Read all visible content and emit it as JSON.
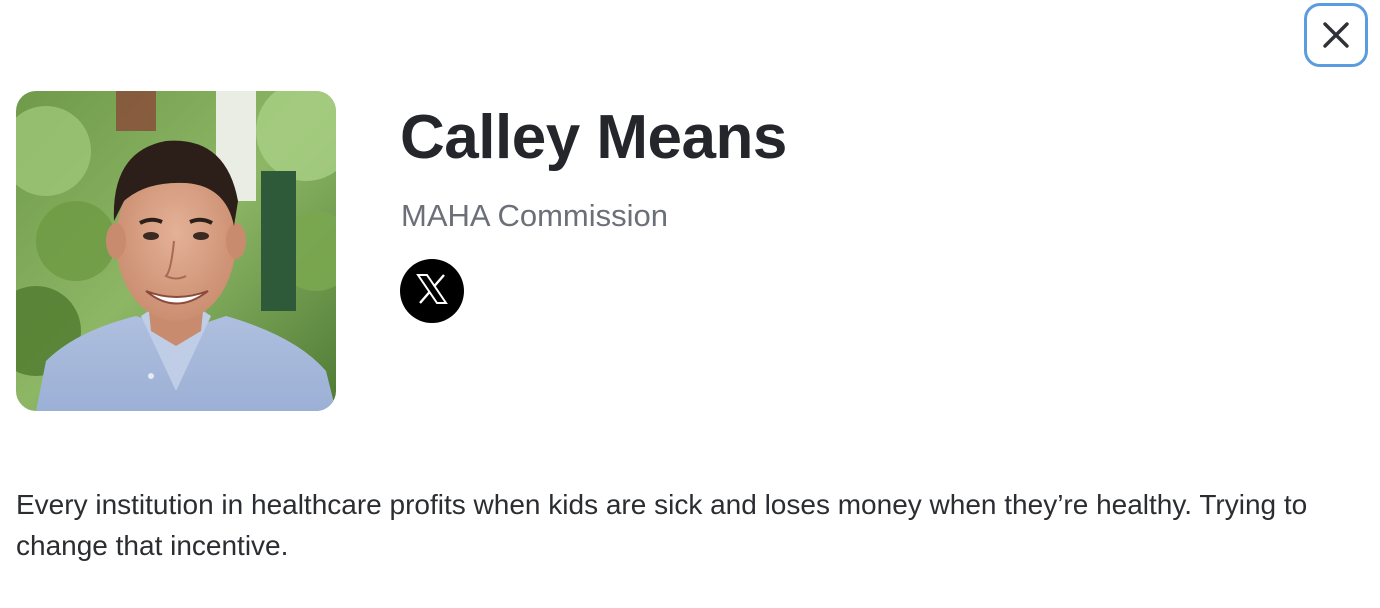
{
  "profile": {
    "name": "Calley Means",
    "organization": "MAHA Commission",
    "bio": "Every institution in healthcare profits when kids are sick and loses money when they’re healthy. Trying to change that incentive.",
    "photo_alt": "Portrait photo"
  },
  "icons": {
    "close": "close-icon",
    "social": "x-logo-icon"
  },
  "colors": {
    "focus_ring": "#5b9bdf",
    "name_text": "#24262b",
    "org_text": "#6b6f78",
    "social_bg": "#000000"
  }
}
